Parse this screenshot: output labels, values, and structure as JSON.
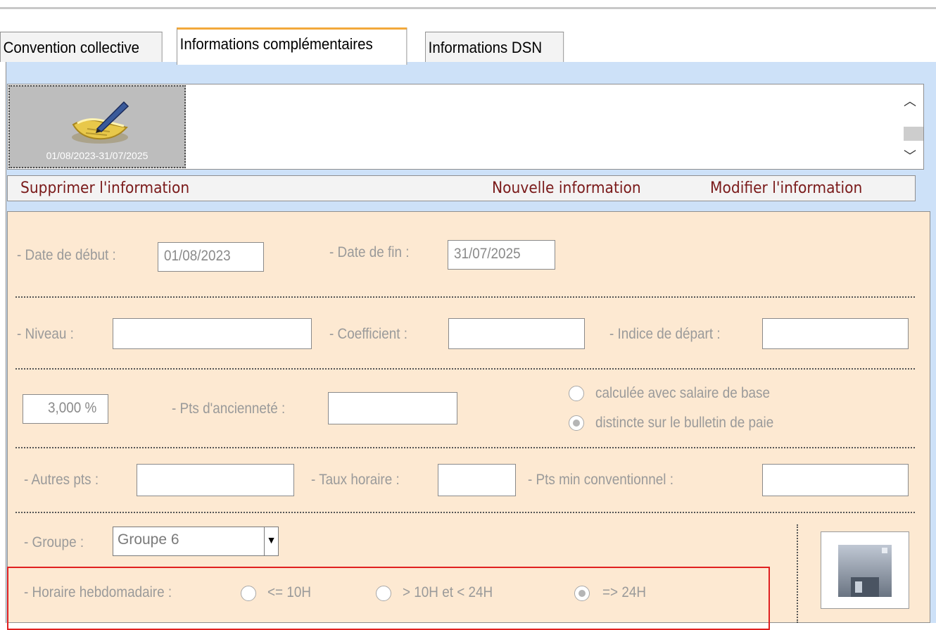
{
  "tabs": [
    {
      "label": "Convention collective",
      "active": false
    },
    {
      "label": "Informations complémentaires",
      "active": true
    },
    {
      "label": "Informations DSN",
      "active": false
    }
  ],
  "timeline": {
    "period_label": "01/08/2023-31/07/2025",
    "icon": "notepad-pen-icon"
  },
  "actions": {
    "delete_label": "Supprimer l'information",
    "new_label": "Nouvelle information",
    "edit_label": "Modifier l'information"
  },
  "form": {
    "date_debut_label": "- Date de début :",
    "date_debut_value": "01/08/2023",
    "date_fin_label": "- Date de fin :",
    "date_fin_value": "31/07/2025",
    "niveau_label": "- Niveau :",
    "niveau_value": "",
    "coefficient_label": "- Coefficient :",
    "coefficient_value": "",
    "indice_label": "- Indice de départ :",
    "indice_value": "",
    "percent_value": "3,000 %",
    "pts_anciennete_label": "- Pts d'ancienneté :",
    "pts_anciennete_value": "",
    "radio_calc_label": "calculée avec salaire de base",
    "radio_distincte_label": "distincte sur le bulletin de paie",
    "autres_pts_label": "- Autres pts :",
    "autres_pts_value": "",
    "taux_horaire_label": "- Taux horaire :",
    "taux_horaire_value": "",
    "pts_min_label": "- Pts min conventionnel :",
    "pts_min_value": "",
    "groupe_label": "- Groupe :",
    "groupe_value": "Groupe 6",
    "horaire_label": "- Horaire hebdomadaire :",
    "horaire_opt1": "<= 10H",
    "horaire_opt2": "> 10H et < 24H",
    "horaire_opt3": "=> 24H",
    "save_icon": "floppy-disk-icon"
  },
  "colors": {
    "tab_accent": "#f2a93b",
    "panel_blue": "#cde1f8",
    "form_bg": "#fde9d2",
    "action_text": "#7a1a1a",
    "highlight_box": "#e02020"
  }
}
